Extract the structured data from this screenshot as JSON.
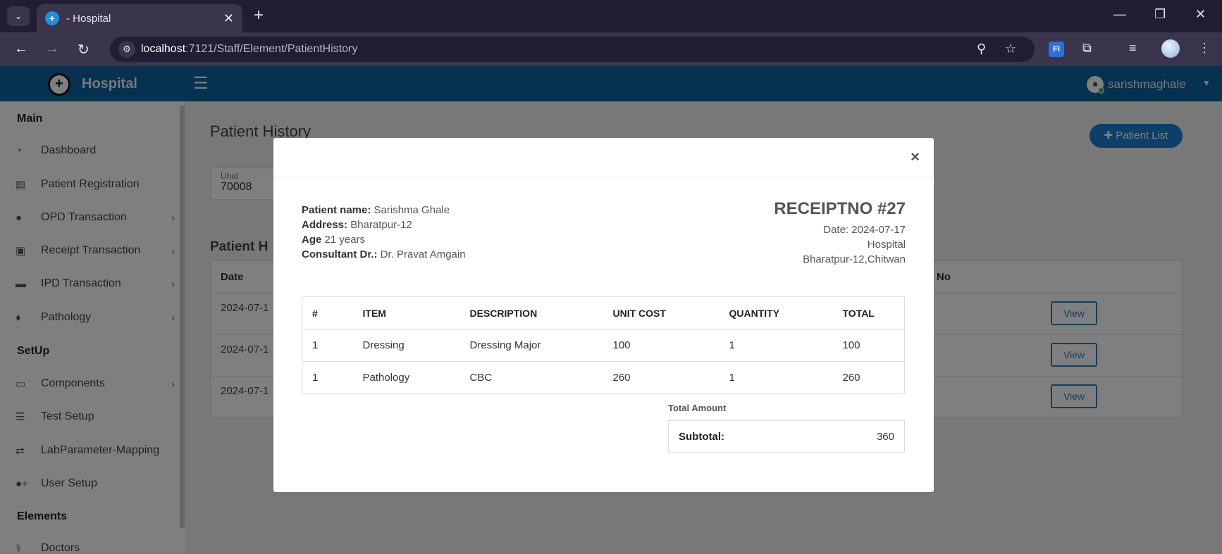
{
  "browser": {
    "tab_title": "- Hospital",
    "url_host": "localhost",
    "url_path": ":7121/Staff/Element/PatientHistory"
  },
  "header": {
    "brand": "Hospital",
    "user_name": "sarishmaghale",
    "accent_color": "#0d63a1"
  },
  "sidebar": {
    "sections": [
      "Main",
      "SetUp",
      "Elements"
    ],
    "items": [
      {
        "label": "Dashboard",
        "icon": "dashboard-icon"
      },
      {
        "label": "Patient Registration",
        "icon": "id-card-icon"
      },
      {
        "label": "OPD Transaction",
        "icon": "user-icon"
      },
      {
        "label": "Receipt Transaction",
        "icon": "money-icon"
      },
      {
        "label": "IPD Transaction",
        "icon": "bed-icon"
      },
      {
        "label": "Pathology",
        "icon": "drop-icon"
      },
      {
        "label": "Components",
        "icon": "laptop-icon"
      },
      {
        "label": "Test Setup",
        "icon": "list-icon"
      },
      {
        "label": "LabParameter-Mapping",
        "icon": "exchange-icon"
      },
      {
        "label": "User Setup",
        "icon": "user-plus-icon"
      },
      {
        "label": "Doctors",
        "icon": "doctor-icon"
      }
    ]
  },
  "page": {
    "title": "Patient History",
    "patient_list_button": "Patient List",
    "uhid_label": "Uhid",
    "uhid_value": "70008",
    "history_title": "Patient H",
    "col_date": "Date",
    "col_no": "No",
    "rows": [
      {
        "date": "2024-07-1",
        "action": "View"
      },
      {
        "date": "2024-07-1",
        "action": "View"
      },
      {
        "date": "2024-07-1",
        "action": "View"
      }
    ]
  },
  "modal": {
    "close": "×",
    "patient_name_label": "Patient name:",
    "patient_name": "Sarishma Ghale",
    "address_label": "Address:",
    "address": "Bharatpur-12",
    "age_label": "Age",
    "age": "21 years",
    "consultant_label": "Consultant Dr.:",
    "consultant": "Dr. Pravat Amgain",
    "receipt_no": "RECEIPTNO #27",
    "date": "Date: 2024-07-17",
    "org": "Hospital",
    "org_address": "Bharatpur-12,Chitwan",
    "table": {
      "headers": [
        "#",
        "ITEM",
        "DESCRIPTION",
        "UNIT COST",
        "QUANTITY",
        "TOTAL"
      ],
      "rows": [
        [
          "1",
          "Dressing",
          "Dressing Major",
          "100",
          "1",
          "100"
        ],
        [
          "1",
          "Pathology",
          "CBC",
          "260",
          "1",
          "260"
        ]
      ]
    },
    "total_amount_label": "Total Amount",
    "subtotal_label": "Subtotal:",
    "subtotal_value": "360"
  }
}
